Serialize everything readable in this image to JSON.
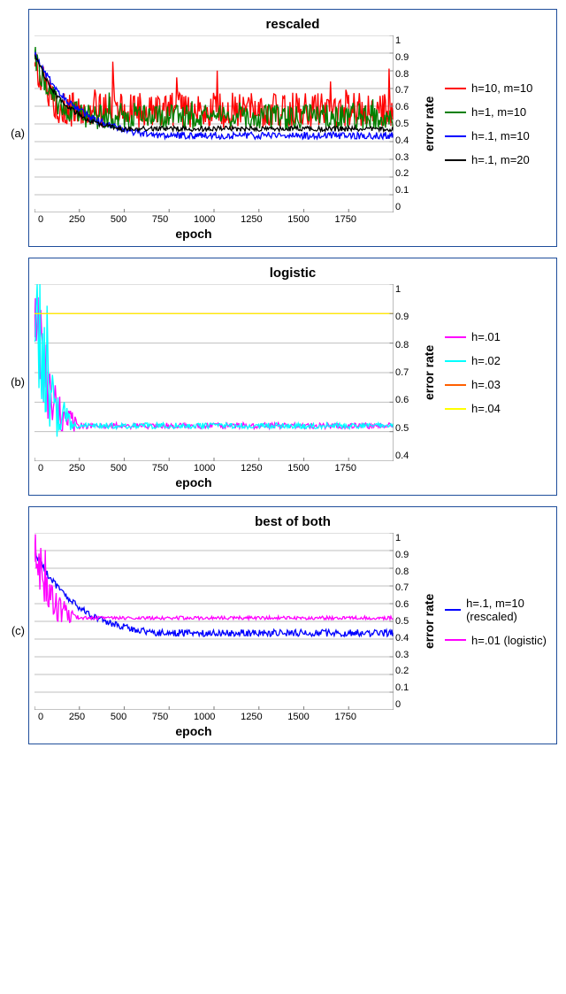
{
  "chart_data": [
    {
      "id": "a",
      "label": "(a)",
      "title": "rescaled",
      "xlabel": "epoch",
      "ylabel": "error rate",
      "xlim": [
        0,
        2000
      ],
      "ylim": [
        0,
        1
      ],
      "xticks": [
        0,
        250,
        500,
        750,
        1000,
        1250,
        1500,
        1750
      ],
      "yticks": [
        0,
        0.1,
        0.2,
        0.3,
        0.4,
        0.5,
        0.6,
        0.7,
        0.8,
        0.9,
        1
      ],
      "type": "line",
      "series": [
        {
          "name": "h=10, m=10",
          "color": "#ff0000",
          "base": 0.56,
          "start": 0.9,
          "noise": 0.1,
          "settle": 200
        },
        {
          "name": "h=1, m=10",
          "color": "#008000",
          "base": 0.52,
          "start": 0.9,
          "noise": 0.07,
          "settle": 300
        },
        {
          "name": "h=.1, m=10",
          "color": "#0000ff",
          "base": 0.41,
          "start": 0.9,
          "noise": 0.02,
          "settle": 700
        },
        {
          "name": "h=.1, m=20",
          "color": "#000000",
          "base": 0.45,
          "start": 0.9,
          "noise": 0.015,
          "settle": 500
        }
      ]
    },
    {
      "id": "b",
      "label": "(b)",
      "title": "logistic",
      "xlabel": "epoch",
      "ylabel": "error rate",
      "xlim": [
        0,
        2000
      ],
      "ylim": [
        0.4,
        1
      ],
      "xticks": [
        0,
        250,
        500,
        750,
        1000,
        1250,
        1500,
        1750
      ],
      "yticks": [
        0.4,
        0.5,
        0.6,
        0.7,
        0.8,
        0.9,
        1
      ],
      "type": "line",
      "series": [
        {
          "name": "h=.01",
          "color": "#ff00ff",
          "base": 0.5,
          "start": 0.9,
          "noise": 0.01,
          "settle": 250,
          "early_noise": 0.18
        },
        {
          "name": "h=.02",
          "color": "#00ffff",
          "base": 0.5,
          "start": 0.9,
          "noise": 0.01,
          "settle": 220,
          "early_noise": 0.22
        },
        {
          "name": "h=.03",
          "color": "#ff6000",
          "flat": 0.9
        },
        {
          "name": "h=.04",
          "color": "#ffff00",
          "flat": 0.9
        }
      ]
    },
    {
      "id": "c",
      "label": "(c)",
      "title": "best of both",
      "xlabel": "epoch",
      "ylabel": "error rate",
      "xlim": [
        0,
        2000
      ],
      "ylim": [
        0,
        1
      ],
      "xticks": [
        0,
        250,
        500,
        750,
        1000,
        1250,
        1500,
        1750
      ],
      "yticks": [
        0,
        0.1,
        0.2,
        0.3,
        0.4,
        0.5,
        0.6,
        0.7,
        0.8,
        0.9,
        1
      ],
      "type": "line",
      "series": [
        {
          "name": "h=.1, m=10 (rescaled)",
          "color": "#0000ff",
          "base": 0.41,
          "start": 0.9,
          "noise": 0.02,
          "settle": 700
        },
        {
          "name": "h=.01 (logistic)",
          "color": "#ff00ff",
          "base": 0.5,
          "start": 0.9,
          "noise": 0.01,
          "settle": 250,
          "early_noise": 0.18
        }
      ]
    }
  ]
}
